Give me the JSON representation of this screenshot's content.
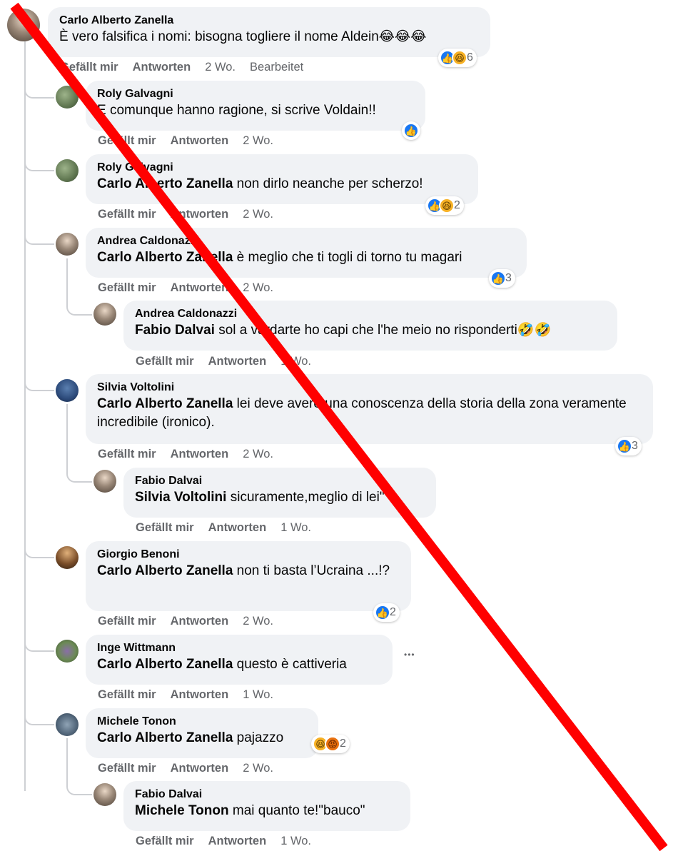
{
  "labels": {
    "like": "Gefällt mir",
    "reply": "Antworten"
  },
  "comments": [
    {
      "author": "Carlo Alberto Zanella",
      "text": "È vero falsifica i nomi: bisogna togliere il nome Aldein",
      "emoji": "😂😂😂",
      "time": "2 Wo.",
      "edited": "Bearbeitet",
      "reactions": [
        "like",
        "haha"
      ],
      "reaction_count": "6"
    },
    {
      "author": "Roly Galvagni",
      "text": "E comunque hanno ragione, si scrive Voldain!!",
      "time": "2 Wo.",
      "reactions": [
        "like"
      ]
    },
    {
      "author": "Roly Galvagni",
      "mention": "Carlo Alberto Zanella",
      "text": "non dirlo neanche per scherzo!",
      "time": "2 Wo.",
      "reactions": [
        "like",
        "haha"
      ],
      "reaction_count": "2"
    },
    {
      "author": "Andrea Caldonazzi",
      "mention": "Carlo Alberto Zanella",
      "text": "è meglio che ti togli di torno tu magari",
      "time": "2 Wo.",
      "reactions": [
        "like"
      ],
      "reaction_count": "3"
    },
    {
      "author": "Andrea Caldonazzi",
      "mention": "Fabio Dalvai",
      "text": "sol a vardarte ho capi che l'he meio no risponderti",
      "emoji": "🤣🤣",
      "time": "1 Wo."
    },
    {
      "author": "Silvia Voltolini",
      "mention": "Carlo Alberto Zanella",
      "text": "lei deve avere una conoscenza della storia della zona veramente incredibile (ironico).",
      "time": "2 Wo.",
      "reactions": [
        "like"
      ],
      "reaction_count": "3"
    },
    {
      "author": "Fabio Dalvai",
      "mention": "Silvia Voltolini",
      "text": "sicuramente,meglio di lei\"",
      "time": "1 Wo."
    },
    {
      "author": "Giorgio Benoni",
      "mention": "Carlo Alberto Zanella",
      "text": "non ti basta l’Ucraina ...!?",
      "time": "2 Wo.",
      "reactions": [
        "like"
      ],
      "reaction_count": "2"
    },
    {
      "author": "Inge Wittmann",
      "mention": "Carlo Alberto Zanella",
      "text": "questo è cattiveria",
      "time": "1 Wo.",
      "more": "•••"
    },
    {
      "author": "Michele Tonon",
      "mention": "Carlo Alberto Zanella",
      "text": "pajazzo",
      "time": "2 Wo.",
      "reactions": [
        "haha",
        "angry"
      ],
      "reaction_count": "2"
    },
    {
      "author": "Fabio Dalvai",
      "mention": "Michele Tonon",
      "text": "mai quanto te!\"bauco\"",
      "time": "1 Wo."
    }
  ],
  "icons": {
    "like": "thumbs-up-icon",
    "haha": "laughing-face-icon",
    "angry": "angry-face-icon",
    "overlay": "red-diagonal-strike"
  },
  "colors": {
    "bubble": "#f0f2f5",
    "meta": "#65676b",
    "like": "#1877f2",
    "strike": "#ff0000"
  }
}
